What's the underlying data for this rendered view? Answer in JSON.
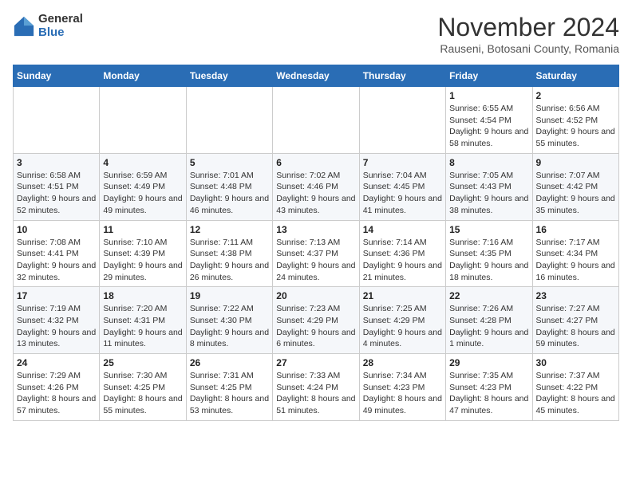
{
  "logo": {
    "general": "General",
    "blue": "Blue"
  },
  "title": "November 2024",
  "subtitle": "Rauseni, Botosani County, Romania",
  "days_of_week": [
    "Sunday",
    "Monday",
    "Tuesday",
    "Wednesday",
    "Thursday",
    "Friday",
    "Saturday"
  ],
  "weeks": [
    [
      {
        "day": "",
        "detail": ""
      },
      {
        "day": "",
        "detail": ""
      },
      {
        "day": "",
        "detail": ""
      },
      {
        "day": "",
        "detail": ""
      },
      {
        "day": "",
        "detail": ""
      },
      {
        "day": "1",
        "detail": "Sunrise: 6:55 AM\nSunset: 4:54 PM\nDaylight: 9 hours and 58 minutes."
      },
      {
        "day": "2",
        "detail": "Sunrise: 6:56 AM\nSunset: 4:52 PM\nDaylight: 9 hours and 55 minutes."
      }
    ],
    [
      {
        "day": "3",
        "detail": "Sunrise: 6:58 AM\nSunset: 4:51 PM\nDaylight: 9 hours and 52 minutes."
      },
      {
        "day": "4",
        "detail": "Sunrise: 6:59 AM\nSunset: 4:49 PM\nDaylight: 9 hours and 49 minutes."
      },
      {
        "day": "5",
        "detail": "Sunrise: 7:01 AM\nSunset: 4:48 PM\nDaylight: 9 hours and 46 minutes."
      },
      {
        "day": "6",
        "detail": "Sunrise: 7:02 AM\nSunset: 4:46 PM\nDaylight: 9 hours and 43 minutes."
      },
      {
        "day": "7",
        "detail": "Sunrise: 7:04 AM\nSunset: 4:45 PM\nDaylight: 9 hours and 41 minutes."
      },
      {
        "day": "8",
        "detail": "Sunrise: 7:05 AM\nSunset: 4:43 PM\nDaylight: 9 hours and 38 minutes."
      },
      {
        "day": "9",
        "detail": "Sunrise: 7:07 AM\nSunset: 4:42 PM\nDaylight: 9 hours and 35 minutes."
      }
    ],
    [
      {
        "day": "10",
        "detail": "Sunrise: 7:08 AM\nSunset: 4:41 PM\nDaylight: 9 hours and 32 minutes."
      },
      {
        "day": "11",
        "detail": "Sunrise: 7:10 AM\nSunset: 4:39 PM\nDaylight: 9 hours and 29 minutes."
      },
      {
        "day": "12",
        "detail": "Sunrise: 7:11 AM\nSunset: 4:38 PM\nDaylight: 9 hours and 26 minutes."
      },
      {
        "day": "13",
        "detail": "Sunrise: 7:13 AM\nSunset: 4:37 PM\nDaylight: 9 hours and 24 minutes."
      },
      {
        "day": "14",
        "detail": "Sunrise: 7:14 AM\nSunset: 4:36 PM\nDaylight: 9 hours and 21 minutes."
      },
      {
        "day": "15",
        "detail": "Sunrise: 7:16 AM\nSunset: 4:35 PM\nDaylight: 9 hours and 18 minutes."
      },
      {
        "day": "16",
        "detail": "Sunrise: 7:17 AM\nSunset: 4:34 PM\nDaylight: 9 hours and 16 minutes."
      }
    ],
    [
      {
        "day": "17",
        "detail": "Sunrise: 7:19 AM\nSunset: 4:32 PM\nDaylight: 9 hours and 13 minutes."
      },
      {
        "day": "18",
        "detail": "Sunrise: 7:20 AM\nSunset: 4:31 PM\nDaylight: 9 hours and 11 minutes."
      },
      {
        "day": "19",
        "detail": "Sunrise: 7:22 AM\nSunset: 4:30 PM\nDaylight: 9 hours and 8 minutes."
      },
      {
        "day": "20",
        "detail": "Sunrise: 7:23 AM\nSunset: 4:29 PM\nDaylight: 9 hours and 6 minutes."
      },
      {
        "day": "21",
        "detail": "Sunrise: 7:25 AM\nSunset: 4:29 PM\nDaylight: 9 hours and 4 minutes."
      },
      {
        "day": "22",
        "detail": "Sunrise: 7:26 AM\nSunset: 4:28 PM\nDaylight: 9 hours and 1 minute."
      },
      {
        "day": "23",
        "detail": "Sunrise: 7:27 AM\nSunset: 4:27 PM\nDaylight: 8 hours and 59 minutes."
      }
    ],
    [
      {
        "day": "24",
        "detail": "Sunrise: 7:29 AM\nSunset: 4:26 PM\nDaylight: 8 hours and 57 minutes."
      },
      {
        "day": "25",
        "detail": "Sunrise: 7:30 AM\nSunset: 4:25 PM\nDaylight: 8 hours and 55 minutes."
      },
      {
        "day": "26",
        "detail": "Sunrise: 7:31 AM\nSunset: 4:25 PM\nDaylight: 8 hours and 53 minutes."
      },
      {
        "day": "27",
        "detail": "Sunrise: 7:33 AM\nSunset: 4:24 PM\nDaylight: 8 hours and 51 minutes."
      },
      {
        "day": "28",
        "detail": "Sunrise: 7:34 AM\nSunset: 4:23 PM\nDaylight: 8 hours and 49 minutes."
      },
      {
        "day": "29",
        "detail": "Sunrise: 7:35 AM\nSunset: 4:23 PM\nDaylight: 8 hours and 47 minutes."
      },
      {
        "day": "30",
        "detail": "Sunrise: 7:37 AM\nSunset: 4:22 PM\nDaylight: 8 hours and 45 minutes."
      }
    ]
  ]
}
